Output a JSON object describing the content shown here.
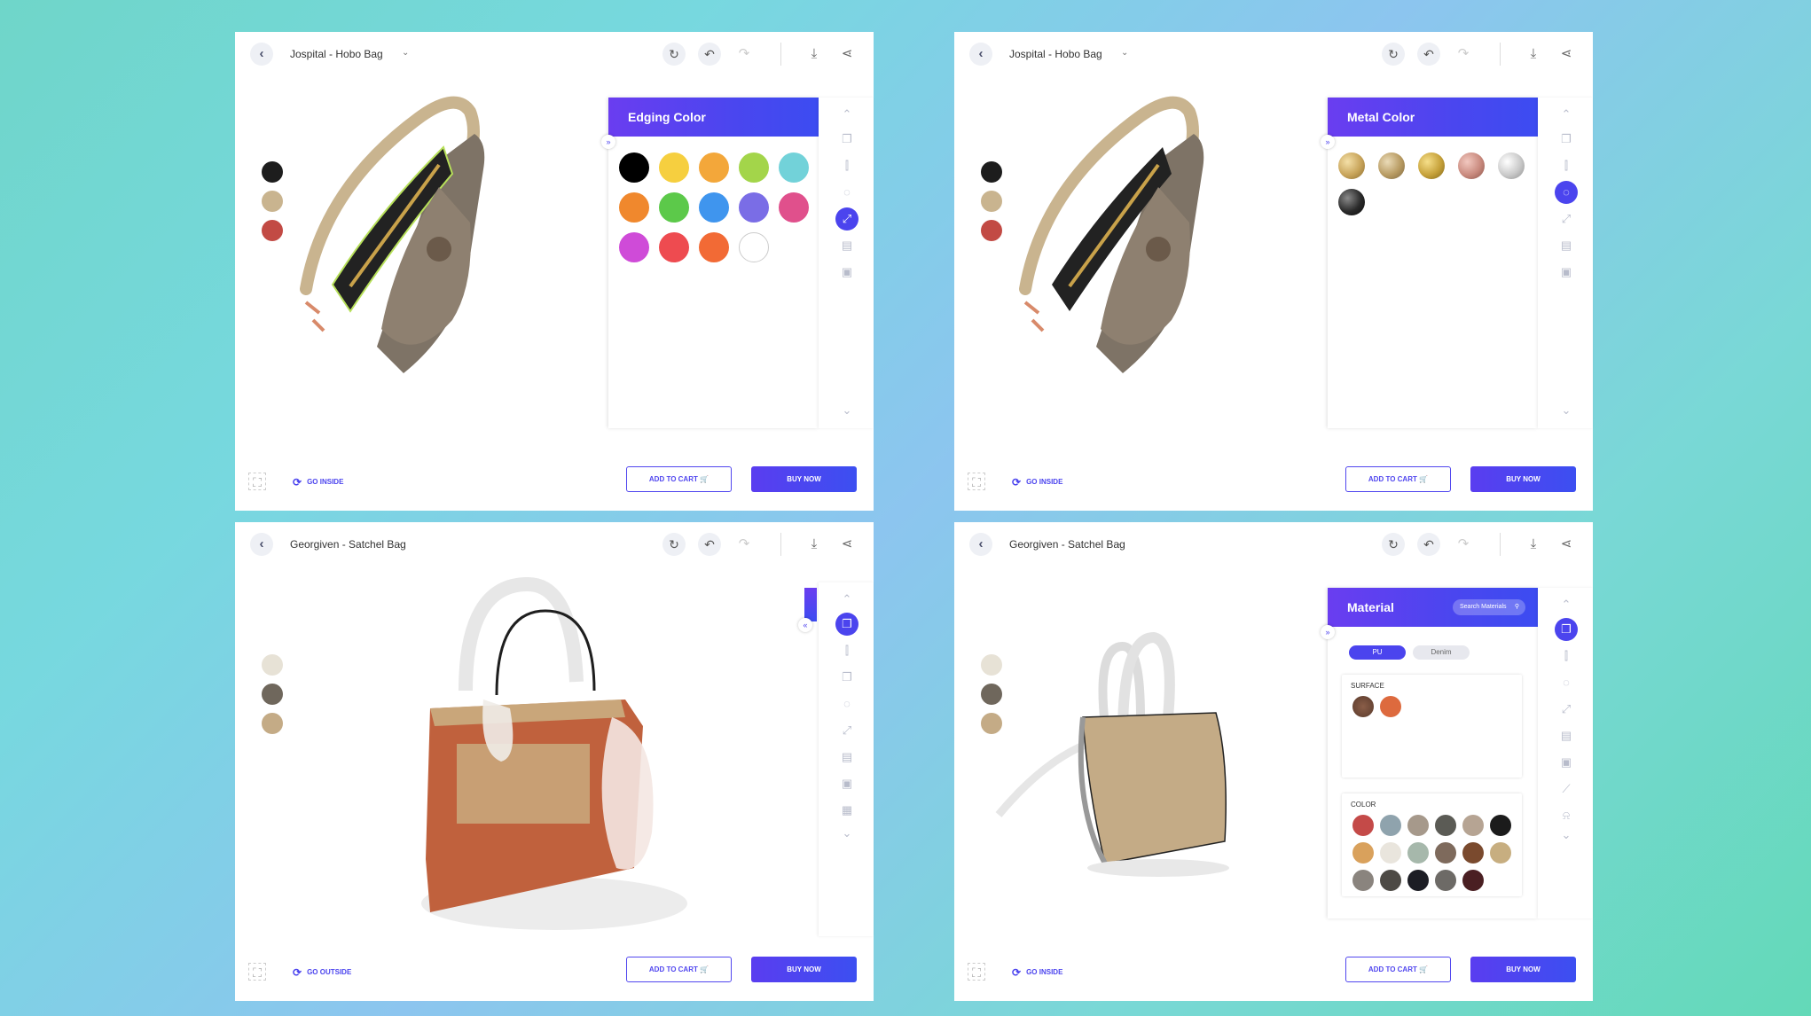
{
  "panels": [
    {
      "title": "Jospital - Hobo Bag",
      "sidepanel_title": "Edging Color",
      "go_label": "GO INSIDE",
      "add_to_cart": "ADD TO CART",
      "buy_now": "BUY NOW",
      "swatches": [
        "#1d1d1d",
        "#c9b48f",
        "#c24a44"
      ],
      "colors": [
        "#000000",
        "#f6cf3f",
        "#f3a73a",
        "#a3d54a",
        "#72d2d9",
        "#f0882d",
        "#5cc94a",
        "#3f95ee",
        "#7a6de6",
        "#e0508c",
        "#cf4bd8",
        "#ee4b50",
        "#f26a35",
        "#ffffff"
      ]
    },
    {
      "title": "Jospital - Hobo Bag",
      "sidepanel_title": "Metal Color",
      "go_label": "GO INSIDE",
      "add_to_cart": "ADD TO CART",
      "buy_now": "BUY NOW",
      "swatches": [
        "#1d1d1d",
        "#c9b48f",
        "#c24a44"
      ],
      "metals": [
        "#c8a45a",
        "#b89b62",
        "#c6a13a",
        "#c98a7e",
        "#c9c9c9",
        "#2a2a2a"
      ]
    },
    {
      "title": "Georgiven - Satchel Bag",
      "go_label": "GO OUTSIDE",
      "add_to_cart": "ADD TO CART",
      "buy_now": "BUY NOW",
      "swatches": [
        "#e7e2d6",
        "#6f675c",
        "#c4ab86"
      ]
    },
    {
      "title": "Georgiven - Satchel Bag",
      "sidepanel_title": "Material",
      "search_placeholder": "Search Materials",
      "tabs": [
        "PU",
        "Denim"
      ],
      "surface_label": "SURFACE",
      "color_label": "COLOR",
      "go_label": "GO INSIDE",
      "add_to_cart": "ADD TO CART",
      "buy_now": "BUY NOW",
      "swatches": [
        "#e7e2d6",
        "#6f675c",
        "#c4ab86"
      ],
      "surfaces": [
        "#6e4a3a",
        "#dd6a3e"
      ],
      "material_colors": [
        "#c44a48",
        "#8fa3ad",
        "#a6998b",
        "#5b5b55",
        "#b6a493",
        "#1b1b1b",
        "#d9a15c",
        "#e9e5dd",
        "#a6b8ab",
        "#7e6a5c",
        "#7a4a2e",
        "#c7ae80",
        "#8a847e",
        "#4d4a45",
        "#1c1d24",
        "#6d6a66",
        "#4a1f22"
      ]
    }
  ],
  "accent": "#4b44ee"
}
